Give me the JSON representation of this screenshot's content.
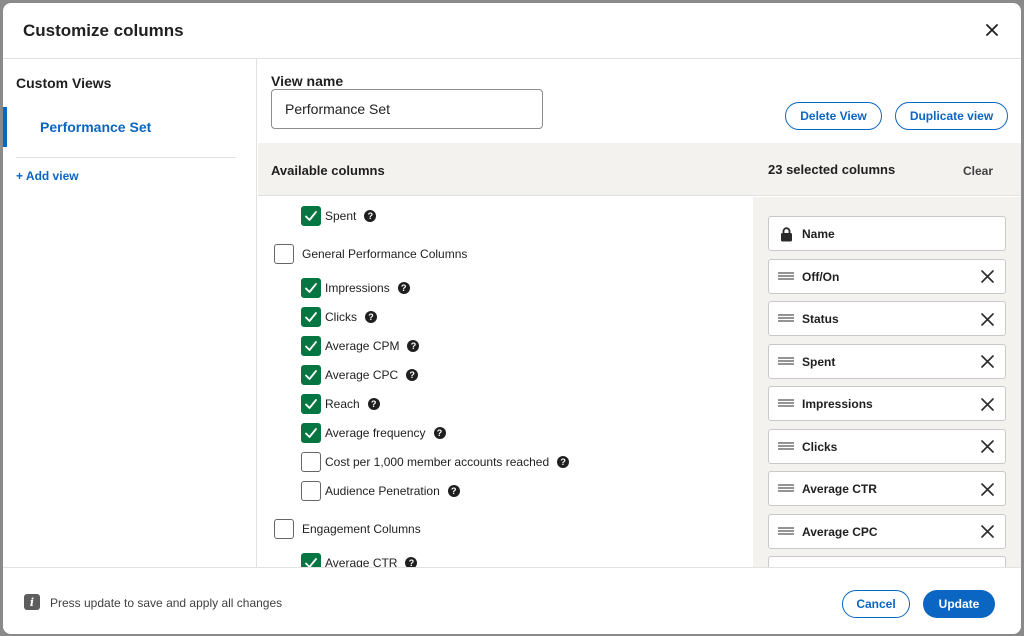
{
  "modal": {
    "title": "Customize columns"
  },
  "sidebar": {
    "title": "Custom Views",
    "items": [
      {
        "label": "Performance Set"
      }
    ],
    "add_label": "+ Add view"
  },
  "view": {
    "name_label": "View name",
    "name_value": "Performance Set",
    "delete_label": "Delete View",
    "duplicate_label": "Duplicate view"
  },
  "columns": {
    "available_label": "Available columns",
    "selected_count_label": "23 selected columns",
    "clear_label": "Clear"
  },
  "available": [
    {
      "label": "Spent",
      "type": "item",
      "checked": true,
      "help": true
    },
    {
      "label": "General Performance Columns",
      "type": "group",
      "checked": false,
      "help": false
    },
    {
      "label": "Impressions",
      "type": "item",
      "checked": true,
      "help": true
    },
    {
      "label": "Clicks",
      "type": "item",
      "checked": true,
      "help": true
    },
    {
      "label": "Average CPM",
      "type": "item",
      "checked": true,
      "help": true
    },
    {
      "label": "Average CPC",
      "type": "item",
      "checked": true,
      "help": true
    },
    {
      "label": "Reach",
      "type": "item",
      "checked": true,
      "help": true
    },
    {
      "label": "Average frequency",
      "type": "item",
      "checked": true,
      "help": true
    },
    {
      "label": "Cost per 1,000 member accounts reached",
      "type": "item",
      "checked": false,
      "help": true
    },
    {
      "label": "Audience Penetration",
      "type": "item",
      "checked": false,
      "help": true
    },
    {
      "label": "Engagement Columns",
      "type": "group",
      "checked": false,
      "help": false
    },
    {
      "label": "Average CTR",
      "type": "item",
      "checked": true,
      "help": true
    }
  ],
  "selected": [
    {
      "label": "Name",
      "icon": "lock-icon",
      "removable": false
    },
    {
      "label": "Off/On",
      "icon": "drag-handle-icon",
      "removable": true
    },
    {
      "label": "Status",
      "icon": "drag-handle-icon",
      "removable": true
    },
    {
      "label": "Spent",
      "icon": "drag-handle-icon",
      "removable": true
    },
    {
      "label": "Impressions",
      "icon": "drag-handle-icon",
      "removable": true
    },
    {
      "label": "Clicks",
      "icon": "drag-handle-icon",
      "removable": true
    },
    {
      "label": "Average CTR",
      "icon": "drag-handle-icon",
      "removable": true
    },
    {
      "label": "Average CPC",
      "icon": "drag-handle-icon",
      "removable": true
    },
    {
      "label": "",
      "icon": "drag-handle-icon",
      "removable": true
    }
  ],
  "footer": {
    "message": "Press update to save and apply all changes",
    "cancel_label": "Cancel",
    "update_label": "Update"
  },
  "colors": {
    "accent": "#0a66c2",
    "check": "#057642",
    "panel_bg": "#f3f2ef"
  }
}
